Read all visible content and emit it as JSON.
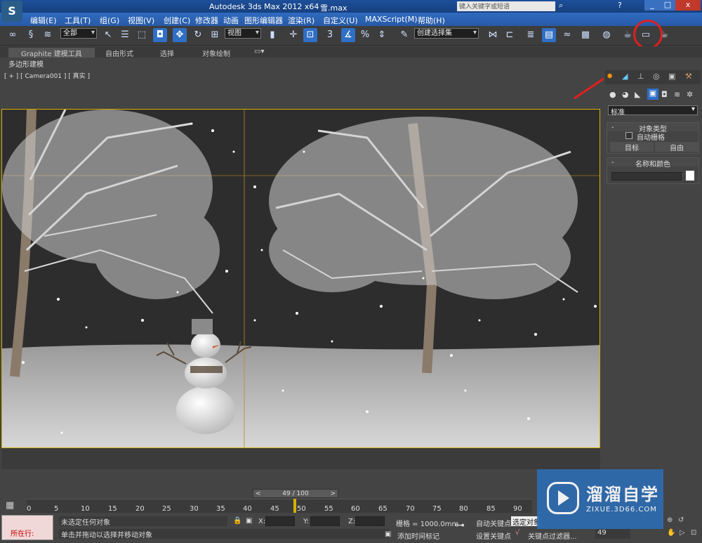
{
  "window": {
    "title": "Autodesk 3ds Max  2012 x64",
    "file": "雪.max",
    "search_placeholder": "键入关键字或短语"
  },
  "menu": [
    "编辑(E)",
    "工具(T)",
    "组(G)",
    "视图(V)",
    "创建(C)",
    "修改器",
    "动画",
    "图形编辑器",
    "渲染(R)",
    "自定义(U)",
    "MAXScript(M)",
    "帮助(H)"
  ],
  "toolbar": {
    "selection_filter": "全部",
    "ref_coord": "视图",
    "named_selection": "创建选择集",
    "snap_value": "3",
    "percent": "%"
  },
  "ribbon": {
    "tabs": [
      "Graphite 建模工具",
      "自由形式",
      "选择",
      "对象绘制"
    ],
    "sub": "多边形建模"
  },
  "viewport": {
    "label": "[ + ] [ Camera001 ] [ 真实 ]"
  },
  "panel": {
    "dropdown": "标准",
    "rollout1": "对象类型",
    "auto_grid": "自动栅格",
    "btn_target": "目标",
    "btn_free": "自由",
    "rollout2": "名称和颜色"
  },
  "timeline": {
    "frame": "49 / 100",
    "ticks": [
      "0",
      "5",
      "10",
      "15",
      "20",
      "25",
      "30",
      "35",
      "40",
      "45",
      "50",
      "55",
      "60",
      "65",
      "70",
      "75",
      "80",
      "85",
      "90"
    ]
  },
  "status": {
    "script_label": "所在行:",
    "selection": "未选定任何对象",
    "prompt": "单击并拖动以选择并移动对象",
    "x": "X:",
    "y": "Y:",
    "z": "Z:",
    "grid": "栅格 = 1000.0mm",
    "add_tag": "添加时间标记",
    "auto_key": "自动关键点",
    "set_key": "设置关键点",
    "sel_obj": "选定对象",
    "key_filter": "关键点过滤器...",
    "frame_field": "49"
  },
  "watermark": {
    "brand": "溜溜自学",
    "url": "ZIXUE.3D66.COM"
  },
  "colors": {
    "title": "#1d4f9a",
    "accent": "#2f6fc5",
    "viewport_border": "#d4b000",
    "annotation": "#e02020"
  }
}
